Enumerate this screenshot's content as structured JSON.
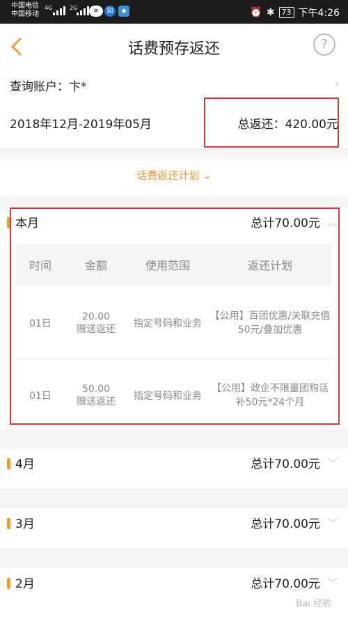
{
  "status_bar": {
    "carrier1": "中国电信",
    "carrier2": "中国移动",
    "net1": "4G",
    "net2": "2G",
    "app_badge": "知",
    "battery": "73",
    "time": "下午4:26"
  },
  "header": {
    "title": "话费预存返还",
    "help": "?"
  },
  "account": {
    "label": "查询账户：卞*",
    "period": "2018年12月-2019年05月",
    "total": "总返还：420.00元"
  },
  "plan_toggle": "话费返还计划 ⌄",
  "current_month": {
    "month": "本月",
    "sum": "总计70.00元",
    "columns": [
      "时间",
      "金额",
      "使用范围",
      "返还计划"
    ],
    "rows": [
      {
        "time": "01日",
        "amount": "20.00",
        "amount_note": "赠送返还",
        "scope": "指定号码和业务",
        "plan": "【公用】百团优惠/关联充值50元/叠加优惠"
      },
      {
        "time": "01日",
        "amount": "50.00",
        "amount_note": "赠送返还",
        "scope": "指定号码和业务",
        "plan": "【公用】政企不限量团购话补50元*24个月"
      }
    ]
  },
  "months": [
    {
      "month": "4月",
      "sum": "总计70.00元"
    },
    {
      "month": "3月",
      "sum": "总计70.00元"
    },
    {
      "month": "2月",
      "sum": "总计70.00元"
    }
  ],
  "watermark": "Bai 经验"
}
